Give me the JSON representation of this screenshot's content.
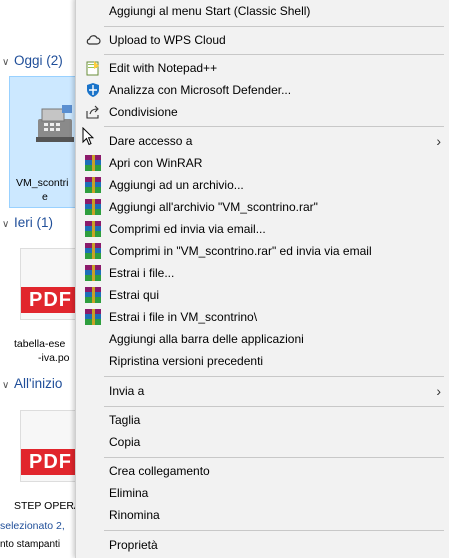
{
  "explorer": {
    "groups": [
      {
        "label": "Oggi (2)"
      },
      {
        "label": "Ieri (1)"
      },
      {
        "label": "All'inizio"
      }
    ],
    "files": [
      {
        "line1": "VM_scontri",
        "line2": "e"
      },
      {
        "line1": "tabella-ese",
        "line2": "-iva.po"
      },
      {
        "line1": "STEP OPERA",
        "line2": ""
      }
    ],
    "pdf_text": "PDF",
    "status": "selezionato 2,",
    "status2": "nto stampanti"
  },
  "menu": {
    "items": [
      {
        "id": "start",
        "label": "Aggiungi al menu Start (Classic Shell)",
        "icon": "none"
      },
      {
        "id": "wps",
        "label": "Upload to WPS Cloud",
        "icon": "cloud-icon"
      },
      {
        "id": "npp",
        "label": "Edit with Notepad++",
        "icon": "notepad-plus-plus-icon"
      },
      {
        "id": "defender",
        "label": "Analizza con Microsoft Defender...",
        "icon": "defender-shield-icon"
      },
      {
        "id": "share",
        "label": "Condivisione",
        "icon": "share-icon"
      },
      {
        "id": "access",
        "label": "Dare accesso a",
        "icon": "none",
        "submenu": true
      },
      {
        "id": "winrar-open",
        "label": "Apri con WinRAR",
        "icon": "winrar-icon"
      },
      {
        "id": "winrar-add",
        "label": "Aggiungi ad un archivio...",
        "icon": "winrar-icon"
      },
      {
        "id": "winrar-add-named",
        "label": "Aggiungi all'archivio \"VM_scontrino.rar\"",
        "icon": "winrar-icon"
      },
      {
        "id": "winrar-email",
        "label": "Comprimi ed invia via email...",
        "icon": "winrar-icon"
      },
      {
        "id": "winrar-email-named",
        "label": "Comprimi in \"VM_scontrino.rar\" ed invia via email",
        "icon": "winrar-icon"
      },
      {
        "id": "winrar-extract",
        "label": "Estrai i file...",
        "icon": "winrar-icon"
      },
      {
        "id": "winrar-extract-here",
        "label": "Estrai qui",
        "icon": "winrar-icon"
      },
      {
        "id": "winrar-extract-folder",
        "label": "Estrai i file in VM_scontrino\\",
        "icon": "winrar-icon"
      },
      {
        "id": "taskbar",
        "label": "Aggiungi alla barra delle applicazioni",
        "icon": "none"
      },
      {
        "id": "restore",
        "label": "Ripristina versioni precedenti",
        "icon": "none"
      },
      {
        "id": "sendto",
        "label": "Invia a",
        "icon": "none",
        "submenu": true
      },
      {
        "id": "cut",
        "label": "Taglia",
        "icon": "none"
      },
      {
        "id": "copy",
        "label": "Copia",
        "icon": "none"
      },
      {
        "id": "shortcut",
        "label": "Crea collegamento",
        "icon": "none"
      },
      {
        "id": "delete",
        "label": "Elimina",
        "icon": "none"
      },
      {
        "id": "rename",
        "label": "Rinomina",
        "icon": "none"
      },
      {
        "id": "props",
        "label": "Proprietà",
        "icon": "none"
      }
    ],
    "submenu_glyph": "›"
  }
}
